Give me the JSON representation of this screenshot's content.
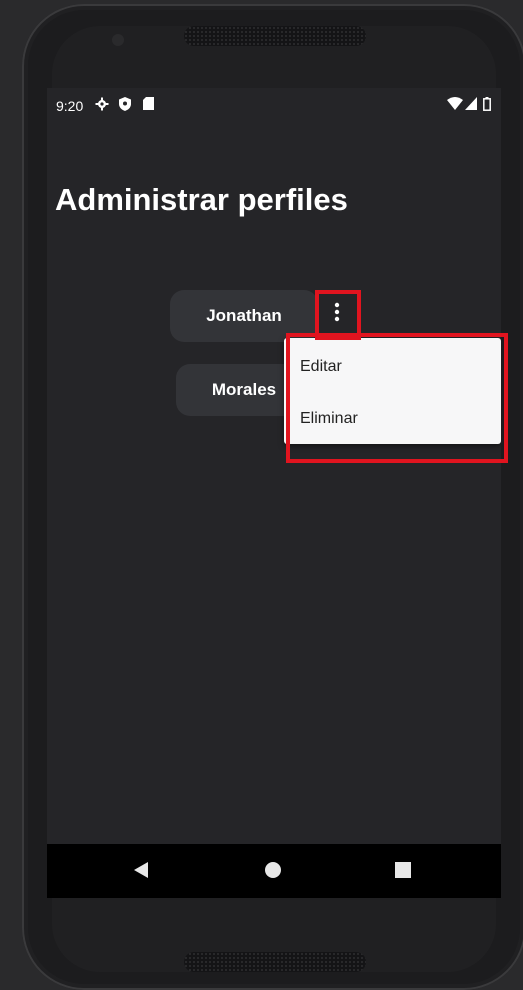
{
  "status_bar": {
    "time": "9:20",
    "icons": [
      "settings-icon",
      "shield-icon",
      "sd-card-icon",
      "wifi-icon",
      "signal-icon",
      "battery-icon"
    ]
  },
  "page": {
    "title": "Administrar perfiles"
  },
  "profiles": [
    {
      "name": "Jonathan"
    },
    {
      "name": "Morales"
    }
  ],
  "more_button": {
    "icon": "more-vertical-icon"
  },
  "context_menu": {
    "items": [
      {
        "label": "Editar"
      },
      {
        "label": "Eliminar"
      }
    ]
  },
  "navigation_bar": {
    "buttons": [
      "back-icon",
      "home-icon",
      "recents-icon"
    ]
  },
  "colors": {
    "screen_bg": "#252528",
    "button_bg": "#333438",
    "menu_bg": "#f7f7f8",
    "highlight": "#e1141f",
    "text_light": "#ffffff"
  }
}
